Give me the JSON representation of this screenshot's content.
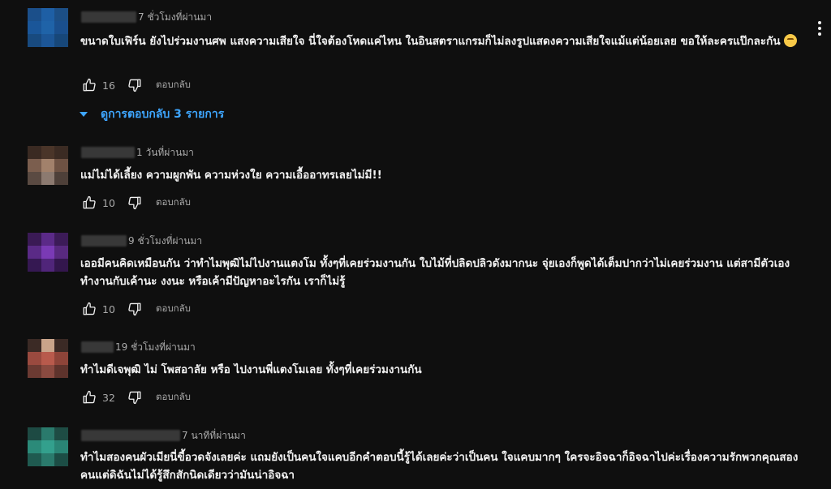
{
  "actions": {
    "reply_label": "ตอบกลับ"
  },
  "comments": [
    {
      "time": "7 ชั่วโมงที่ผ่านมา",
      "text": "ขนาดใบเฟิร์น ยังไปร่วมงานศพ แสงความเสียใจ นี่ใจต้องโหดแค่ไหน ในอินสตราแกรมก็ไม่ลงรูปแสดงความเสียใจแม้แต่น้อยเลย ขอให้ละครแป๊กละกัน",
      "emoji": "face-with-rolling-eyes-emoji",
      "likes": "16",
      "replies_label": "ดูการตอบกลับ 3 รายการ"
    },
    {
      "time": "1 วันที่ผ่านมา",
      "text": "แม่ไม่ได้เลี้ยง ความผูกพัน ความห่วงใย ความเอื้ออาทรเลยไม่มี!!",
      "likes": "10"
    },
    {
      "time": "9 ชั่วโมงที่ผ่านมา",
      "text": "เออมีคนคิดเหมือนกัน  ว่าทำไมพุฒิไม่ไปงานแตงโม   ทั้งๆที่เคยร่วมงานกัน  ใบไม้ที่ปลิดปลิวดังมากนะ   จุ่ยเองก็พูดได้เต็มปากว่าไม่เคยร่วมงาน  แต่สามีตัวเองทำงานกับเค้านะ  งงนะ   หรือเค้ามีปัญหาอะไรกัน เราก็ไม่รู้",
      "likes": "10"
    },
    {
      "time": "19 ชั่วโมงที่ผ่านมา",
      "text": "ทำไมดีเจพุฒิ ไม่ โพสอาลัย หรือ ไปงานพี่แตงโมเลย ทั้งๆที่เคยร่วมงานกัน",
      "likes": "32"
    },
    {
      "time": "7 นาทีที่ผ่านมา",
      "text": "ทำไมสองคนผัวเมียนี่ขี้อวดจังเลยค่ะ แถมยังเป็นคนใจแคบอีกคำตอบนี้รู้ได้เลยค่ะว่าเป็นคน ใจแคบมากๆ ใครจะอิจฉาก็อิจฉาไปค่ะเรื่องความรักพวกคุณสองคนแต่ดิฉันไม่ได้รู้สึกสักนิดเดียวว่ามันน่าอิจฉา"
    }
  ]
}
